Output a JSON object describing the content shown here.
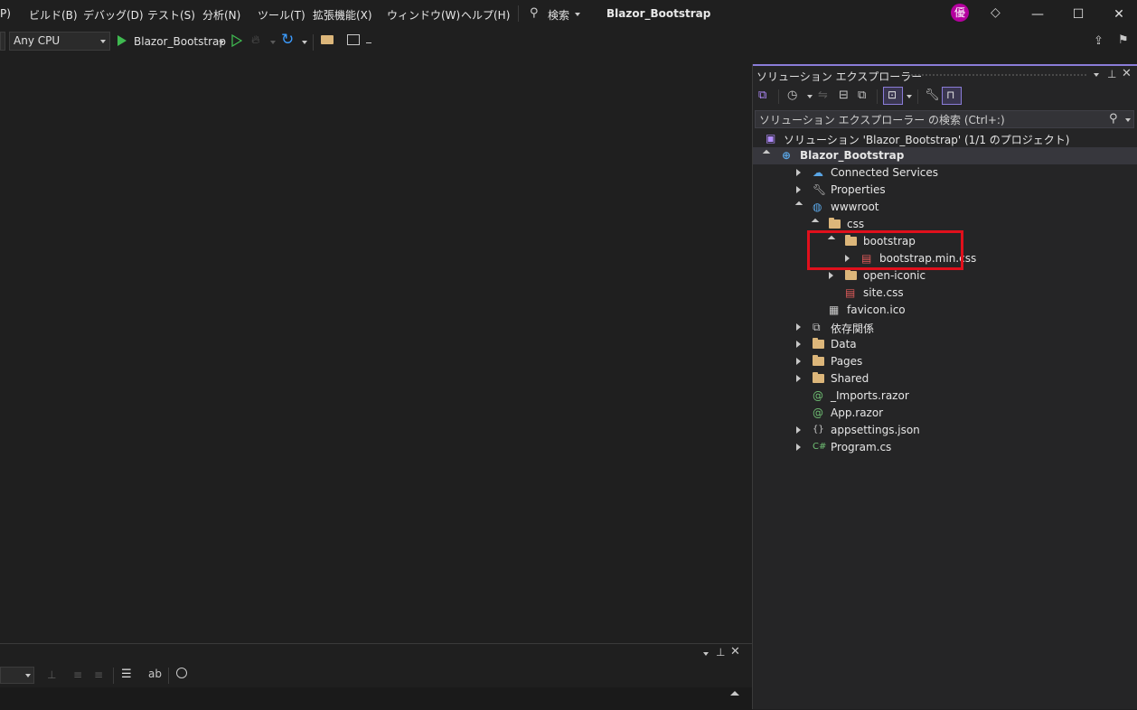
{
  "menubar": {
    "items": [
      "P)",
      "ビルド(B)",
      "デバッグ(D)",
      "テスト(S)",
      "分析(N)",
      "ツール(T)",
      "拡張機能(X)",
      "ウィンドウ(W)",
      "ヘルプ(H)"
    ],
    "search_label": "検索",
    "window_title": "Blazor_Bootstrap",
    "avatar_text": "優",
    "minimize_glyph": "—",
    "maximize_glyph": "☐",
    "close_glyph": "✕"
  },
  "toolbar": {
    "platform": "Any CPU",
    "run_target": "Blazor_Bootstrap"
  },
  "solution_explorer": {
    "title": "ソリューション エクスプローラー",
    "search_placeholder": "ソリューション エクスプローラー の検索 (Ctrl+:)",
    "tree": [
      {
        "label": "ソリューション 'Blazor_Bootstrap' (1/1 のプロジェクト)",
        "icon": "solution-icon",
        "level": 0,
        "arrow": "none"
      },
      {
        "label": "Blazor_Bootstrap",
        "icon": "web-project-icon",
        "level": 0,
        "arrow": "expanded",
        "selected": true
      },
      {
        "label": "Connected Services",
        "icon": "connected-services-icon",
        "level": 1,
        "arrow": "collapsed"
      },
      {
        "label": "Properties",
        "icon": "properties-icon",
        "level": 1,
        "arrow": "collapsed"
      },
      {
        "label": "wwwroot",
        "icon": "globe-icon",
        "level": 1,
        "arrow": "expanded"
      },
      {
        "label": "css",
        "icon": "folder-icon",
        "level": 2,
        "arrow": "expanded"
      },
      {
        "label": "bootstrap",
        "icon": "folder-icon",
        "level": 3,
        "arrow": "expanded"
      },
      {
        "label": "bootstrap.min.css",
        "icon": "css-file-icon",
        "level": 4,
        "arrow": "collapsed"
      },
      {
        "label": "open-iconic",
        "icon": "folder-icon",
        "level": 3,
        "arrow": "collapsed"
      },
      {
        "label": "site.css",
        "icon": "css-file-icon",
        "level": 3,
        "arrow": "none"
      },
      {
        "label": "favicon.ico",
        "icon": "image-file-icon",
        "level": 2,
        "arrow": "none"
      },
      {
        "label": "依存関係",
        "icon": "dependencies-icon",
        "level": 1,
        "arrow": "collapsed"
      },
      {
        "label": "Data",
        "icon": "folder-icon",
        "level": 1,
        "arrow": "collapsed"
      },
      {
        "label": "Pages",
        "icon": "folder-icon",
        "level": 1,
        "arrow": "collapsed"
      },
      {
        "label": "Shared",
        "icon": "folder-icon",
        "level": 1,
        "arrow": "collapsed"
      },
      {
        "label": "_Imports.razor",
        "icon": "razor-file-icon",
        "level": 1,
        "arrow": "none"
      },
      {
        "label": "App.razor",
        "icon": "razor-file-icon",
        "level": 1,
        "arrow": "none"
      },
      {
        "label": "appsettings.json",
        "icon": "json-file-icon",
        "level": 1,
        "arrow": "collapsed"
      },
      {
        "label": "Program.cs",
        "icon": "csharp-file-icon",
        "level": 1,
        "arrow": "collapsed"
      }
    ]
  },
  "colors": {
    "accent": "#8a7cd8",
    "highlight_box": "#e0101c",
    "run_green": "#3fb950",
    "avatar_bg": "#b4009e",
    "folder": "#dcb67a"
  }
}
